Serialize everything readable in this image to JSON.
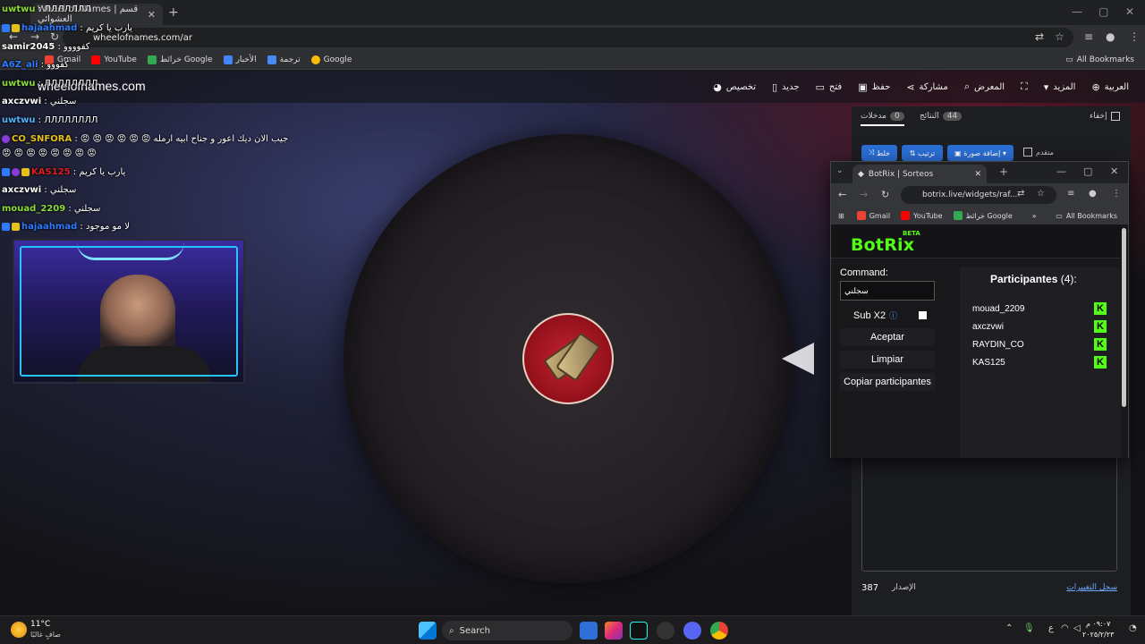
{
  "browser": {
    "tab_title": "Wheel of Names | قسم العشوائي",
    "url": "wheelofnames.com/ar",
    "bookmarks": [
      "Gmail",
      "YouTube",
      "خرائط Google",
      "الأخبار",
      "ترجمة",
      "Google"
    ],
    "all_bookmarks": "All Bookmarks"
  },
  "site": {
    "brand": "wheelofnames.com",
    "nav": {
      "customize": "تخصيص",
      "new": "جديد",
      "open": "فتح",
      "save": "حفظ",
      "share": "مشاركة",
      "gallery": "المعرض",
      "more": "المزيد",
      "language": "العربية"
    }
  },
  "panel": {
    "entries_tab": "مدخلات",
    "entries_count": "0",
    "results_tab": "النتائج",
    "results_count": "44",
    "hide": "إخفاء",
    "shuffle": "خلط",
    "sort": "ترتيب",
    "add_image": "إضافة صورة",
    "advanced": "متقدم",
    "version_label": "الإصدار",
    "version": "387",
    "changelog": "سجل التغييرات"
  },
  "chat": [
    {
      "user": "uwtwu",
      "message": "ЛЛЛЛЛЛЛ",
      "color": "#8bdc3a"
    },
    {
      "user": "hajaahmad",
      "message": "يارب يا كريم",
      "color": "#2e7bff"
    },
    {
      "user": "samir2045",
      "message": "كفوووو",
      "color": "#ffffff"
    },
    {
      "user": "A6Z_ali",
      "message": "كفووو",
      "color": "#2e7bff"
    },
    {
      "user": "uwtwu",
      "message": "ЛЛЛЛЛЛЛЛ",
      "color": "#8bdc3a"
    },
    {
      "user": "axczvwi",
      "message": "سجلني",
      "color": "#ffffff"
    },
    {
      "user": "uwtwu",
      "message": "ЛЛЛЛЛЛЛЛ",
      "color": "#4fb3ff"
    },
    {
      "user": "CO_SNFORA",
      "message": "😡 😡 😡 😡 😡 😡 جيب الان ديك اعور و جناح ابيه ارمله",
      "color": "#e6c01a"
    },
    {
      "user": "",
      "message": "😡 😡 😡 😡 😡 😡 😡 😡",
      "color": "#ffffff"
    },
    {
      "user": "KAS125",
      "message": "يارب يا كريم",
      "color": "#e02020"
    },
    {
      "user": "axczvwi",
      "message": "سجلني",
      "color": "#ffffff"
    },
    {
      "user": "mouad_2209",
      "message": "سجلني",
      "color": "#8bdc3a"
    },
    {
      "user": "hajaahmad",
      "message": "لا مو موجود",
      "color": "#2e7bff"
    }
  ],
  "popup": {
    "tab_title": "BotRix | Sorteos",
    "url": "botrix.live/widgets/raf...",
    "bookmarks": [
      "Gmail",
      "YouTube",
      "خرائط Google"
    ],
    "all_bookmarks": "All Bookmarks",
    "logo": "BotRix",
    "beta": "BETA",
    "command_label": "Command:",
    "command_value": "سجلني",
    "subx2_label": "Sub X2",
    "accept": "Aceptar",
    "clear": "Limpiar",
    "copy": "Copiar participantes",
    "participants_label": "Participantes",
    "participants_count": "(4):",
    "participants": [
      "mouad_2209",
      "axczvwi",
      "RAYDIN_CO",
      "KAS125"
    ],
    "kick_icon": "K"
  },
  "taskbar": {
    "weather_temp": "11°C",
    "weather_desc": "صافٍ غالبًا",
    "search": "Search",
    "time": "٠٩:٠٧ م",
    "date": "٢٠٢٥/٢/٢٣",
    "lang": "ع"
  }
}
